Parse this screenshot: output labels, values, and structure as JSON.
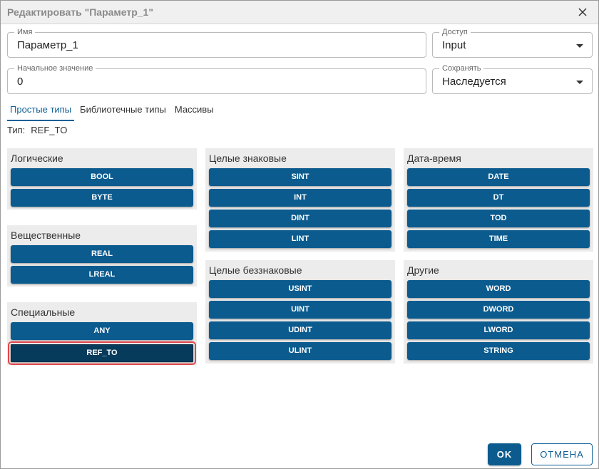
{
  "dialog": {
    "title": "Редактировать \"Параметр_1\""
  },
  "fields": {
    "name": {
      "label": "Имя",
      "value": "Параметр_1"
    },
    "access": {
      "label": "Доступ",
      "value": "Input"
    },
    "initial": {
      "label": "Начальное значение",
      "value": "0"
    },
    "save": {
      "label": "Сохранять",
      "value": "Наследуется"
    }
  },
  "tabs": [
    {
      "label": "Простые типы"
    },
    {
      "label": "Библиотечные типы"
    },
    {
      "label": "Массивы"
    }
  ],
  "type": {
    "label": "Тип:",
    "value": "REF_TO"
  },
  "groups": {
    "logical": {
      "title": "Логические",
      "items": [
        "BOOL",
        "BYTE"
      ]
    },
    "real": {
      "title": "Вещественные",
      "items": [
        "REAL",
        "LREAL"
      ]
    },
    "special": {
      "title": "Специальные",
      "items": [
        "ANY",
        "REF_TO"
      ]
    },
    "signed": {
      "title": "Целые знаковые",
      "items": [
        "SINT",
        "INT",
        "DINT",
        "LINT"
      ]
    },
    "unsigned": {
      "title": "Целые беззнаковые",
      "items": [
        "USINT",
        "UINT",
        "UDINT",
        "ULINT"
      ]
    },
    "datetime": {
      "title": "Дата-время",
      "items": [
        "DATE",
        "DT",
        "TOD",
        "TIME"
      ]
    },
    "other": {
      "title": "Другие",
      "items": [
        "WORD",
        "DWORD",
        "LWORD",
        "STRING"
      ]
    }
  },
  "buttons": {
    "ok": "OK",
    "cancel": "ОТМЕНА"
  },
  "colors": {
    "accent": "#0b5b8f",
    "selected": "#073b5c",
    "highlight": "#e1474a"
  }
}
